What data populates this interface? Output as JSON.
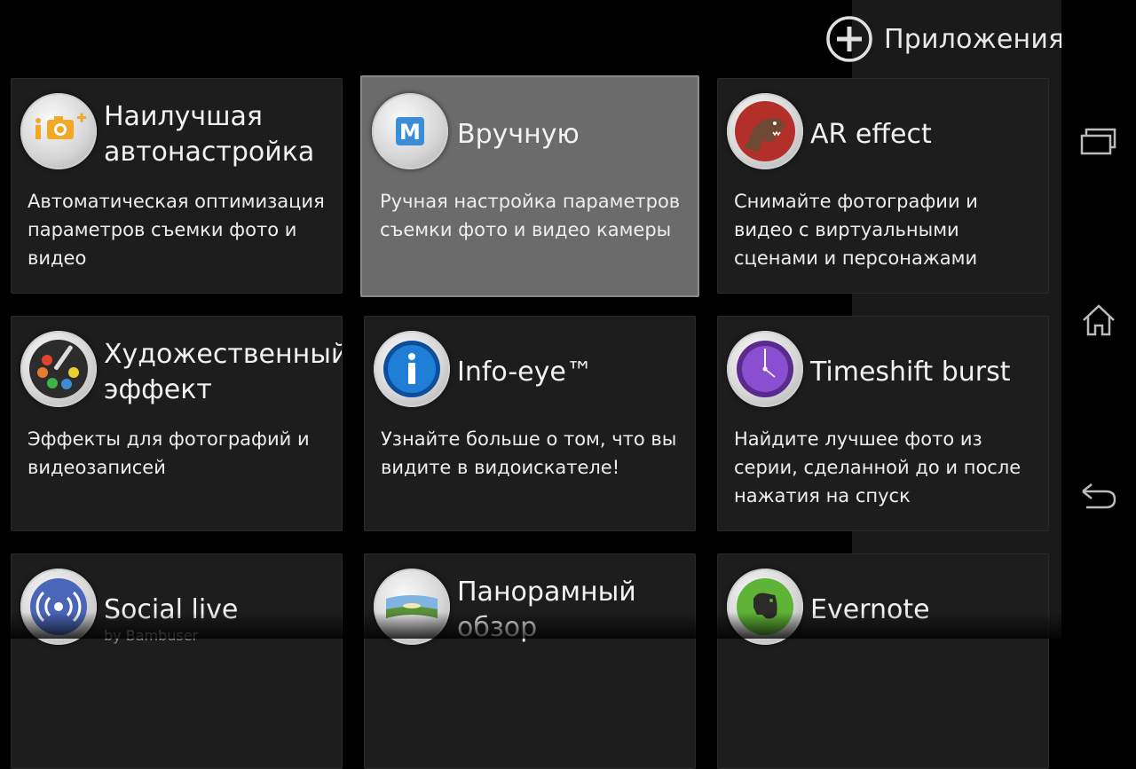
{
  "header": {
    "apps_label": "Приложения",
    "apps_icon": "plus-circle-icon"
  },
  "tiles": [
    {
      "title": "Наилучшая автонастройка",
      "description": "Автоматическая оптимизация параметров съемки фото и видео",
      "icon": "superior-auto-camera-icon",
      "selected": false
    },
    {
      "title": "Вручную",
      "description": "Ручная настройка параметров съемки фото и видео камеры",
      "icon": "manual-m-icon",
      "selected": true
    },
    {
      "title": "AR effect",
      "description": "Снимайте фотографии и видео с виртуальными сценами и персонажами",
      "icon": "dinosaur-icon",
      "selected": false
    },
    {
      "title": "Художественный эффект",
      "description": "Эффекты для фотографий и видеозаписей",
      "icon": "palette-icon",
      "selected": false
    },
    {
      "title": "Info-eye™",
      "description": "Узнайте больше о том, что вы видите в видоискателе!",
      "icon": "info-icon",
      "selected": false
    },
    {
      "title": "Timeshift burst",
      "description": "Найдите лучшее фото из серии, сделанной до и после нажатия на спуск",
      "icon": "timeshift-clock-icon",
      "selected": false
    },
    {
      "title": "Social live",
      "subtitle": "by Bambuser",
      "description": "",
      "icon": "broadcast-icon",
      "selected": false
    },
    {
      "title": "Панорамный обзор",
      "description": "",
      "icon": "panorama-landscape-icon",
      "selected": false
    },
    {
      "title": "Evernote",
      "description": "",
      "icon": "evernote-elephant-icon",
      "selected": false
    }
  ],
  "navbar": {
    "recent_icon": "recent-apps-icon",
    "home_icon": "home-icon",
    "back_icon": "back-arrow-icon"
  },
  "colors": {
    "tile_bg": "#1d1d1d",
    "tile_selected_bg": "#6b6b6b",
    "background": "#000000"
  }
}
